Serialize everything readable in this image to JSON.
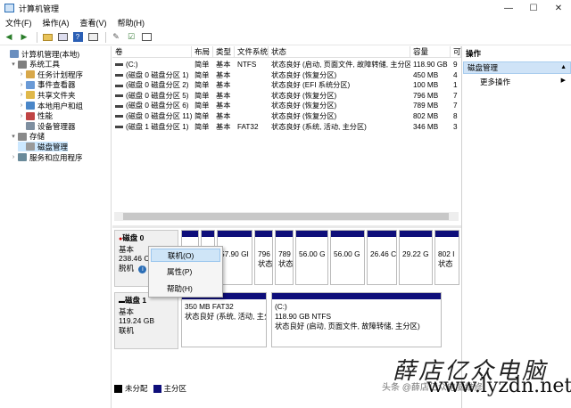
{
  "window": {
    "title": "计算机管理",
    "buttons": [
      "—",
      "☐",
      "✕"
    ]
  },
  "menu": [
    "文件(F)",
    "操作(A)",
    "查看(V)",
    "帮助(H)"
  ],
  "tree": [
    {
      "label": "计算机管理(本地)",
      "level": 0,
      "icon": "computer-icon",
      "arrow": ""
    },
    {
      "label": "系统工具",
      "level": 1,
      "icon": "tools-icon",
      "arrow": "▾"
    },
    {
      "label": "任务计划程序",
      "level": 2,
      "icon": "clock-icon",
      "arrow": "›"
    },
    {
      "label": "事件查看器",
      "level": 2,
      "icon": "event-icon",
      "arrow": "›"
    },
    {
      "label": "共享文件夹",
      "level": 2,
      "icon": "folder-icon",
      "arrow": "›"
    },
    {
      "label": "本地用户和组",
      "level": 2,
      "icon": "users-icon",
      "arrow": "›"
    },
    {
      "label": "性能",
      "level": 2,
      "icon": "performance-icon",
      "arrow": "›"
    },
    {
      "label": "设备管理器",
      "level": 2,
      "icon": "device-icon",
      "arrow": ""
    },
    {
      "label": "存储",
      "level": 1,
      "icon": "storage-icon",
      "arrow": "▾"
    },
    {
      "label": "磁盘管理",
      "level": 2,
      "icon": "disk-icon",
      "arrow": "",
      "selected": true
    },
    {
      "label": "服务和应用程序",
      "level": 1,
      "icon": "services-icon",
      "arrow": "›"
    }
  ],
  "volume_table": {
    "columns": [
      "卷",
      "布局",
      "类型",
      "文件系统",
      "状态",
      "容量",
      "可"
    ],
    "rows": [
      [
        "(C:)",
        "简单",
        "基本",
        "NTFS",
        "状态良好 (启动, 页面文件, 故障转储, 主分区)",
        "118.90 GB",
        "9"
      ],
      [
        "(磁盘 0 磁盘分区 1)",
        "简单",
        "基本",
        "",
        "状态良好 (恢复分区)",
        "450 MB",
        "4"
      ],
      [
        "(磁盘 0 磁盘分区 2)",
        "简单",
        "基本",
        "",
        "状态良好 (EFI 系统分区)",
        "100 MB",
        "1"
      ],
      [
        "(磁盘 0 磁盘分区 5)",
        "简单",
        "基本",
        "",
        "状态良好 (恢复分区)",
        "796 MB",
        "7"
      ],
      [
        "(磁盘 0 磁盘分区 6)",
        "简单",
        "基本",
        "",
        "状态良好 (恢复分区)",
        "789 MB",
        "7"
      ],
      [
        "(磁盘 0 磁盘分区 11)",
        "简单",
        "基本",
        "",
        "状态良好 (恢复分区)",
        "802 MB",
        "8"
      ],
      [
        "(磁盘 1 磁盘分区 1)",
        "简单",
        "基本",
        "FAT32",
        "状态良好 (系统, 活动, 主分区)",
        "346 MB",
        "3"
      ]
    ]
  },
  "disk0": {
    "name": "磁盘 0",
    "type": "基本",
    "size": "238.46 C",
    "status": "脱机",
    "partitions": [
      {
        "label": "",
        "sub": ""
      },
      {
        "label": "",
        "sub": ""
      },
      {
        "label": "57.90 GI",
        "sub": ""
      },
      {
        "label": "796",
        "sub": "状态"
      },
      {
        "label": "789",
        "sub": "状态"
      },
      {
        "label": "56.00 G",
        "sub": ""
      },
      {
        "label": "56.00 G",
        "sub": ""
      },
      {
        "label": "26.46 C",
        "sub": ""
      },
      {
        "label": "29.22 G",
        "sub": ""
      },
      {
        "label": "802 I",
        "sub": "状态"
      }
    ]
  },
  "disk1": {
    "name": "磁盘 1",
    "type": "基本",
    "size": "119.24 GB",
    "status": "联机",
    "partitions": [
      {
        "title": "",
        "size": "350 MB FAT32",
        "status": "状态良好 (系统, 活动, 主分"
      },
      {
        "title": "(C:)",
        "size": "118.90 GB NTFS",
        "status": "状态良好 (启动, 页面文件, 故障转储, 主分区)"
      }
    ]
  },
  "context_menu": [
    "联机(O)",
    "属性(P)",
    "帮助(H)"
  ],
  "legend": [
    {
      "label": "未分配",
      "color": "#000000"
    },
    {
      "label": "主分区",
      "color": "#0e0e7a"
    }
  ],
  "actions": {
    "header": "操作",
    "selected": "磁盘管理",
    "more": "更多操作"
  },
  "watermark": {
    "brand": "薛店亿众电脑",
    "author": "头条 @薛店亿众电脑维修",
    "url": "www.lyzdn.net"
  }
}
